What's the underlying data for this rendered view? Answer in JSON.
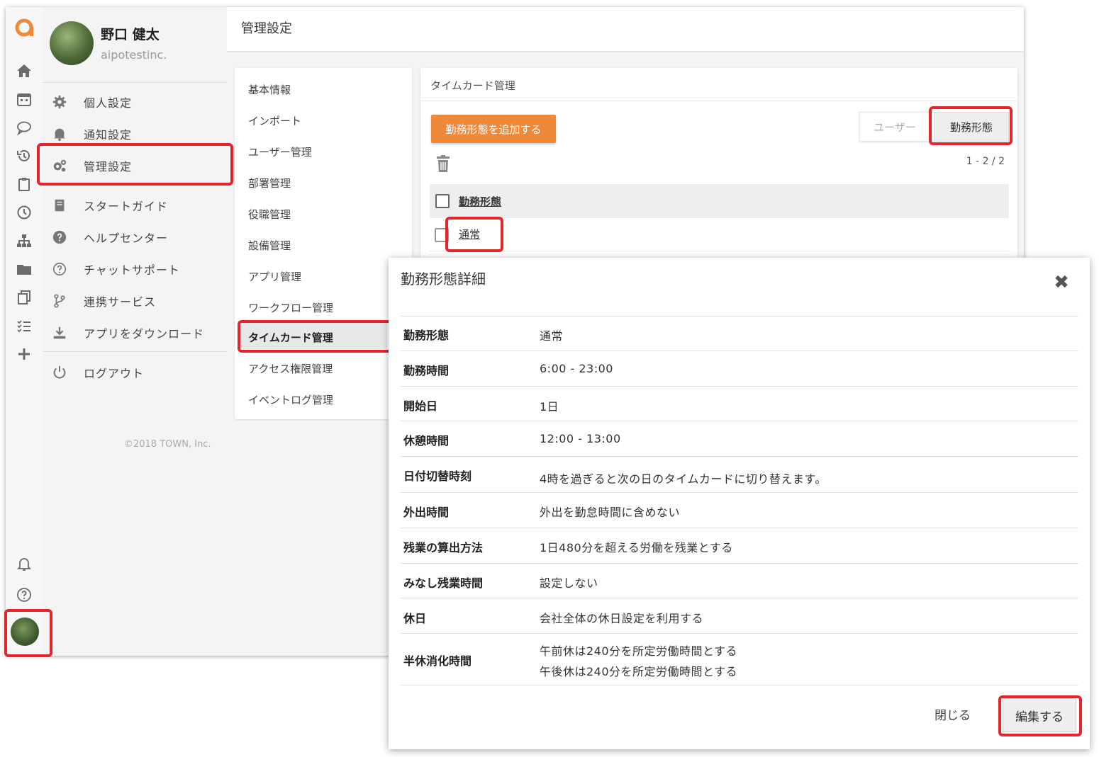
{
  "user": {
    "name": "野口 健太",
    "org": "aipotestinc."
  },
  "side_menu": {
    "items": [
      {
        "label": "個人設定",
        "icon": "gear-icon"
      },
      {
        "label": "通知設定",
        "icon": "bell-icon"
      },
      {
        "label": "管理設定",
        "icon": "gears-icon"
      },
      {
        "label": "スタートガイド",
        "icon": "book-icon"
      },
      {
        "label": "ヘルプセンター",
        "icon": "help-circle-icon"
      },
      {
        "label": "チャットサポート",
        "icon": "question-outline-icon"
      },
      {
        "label": "連携サービス",
        "icon": "branch-icon"
      },
      {
        "label": "アプリをダウンロード",
        "icon": "download-icon"
      },
      {
        "label": "ログアウト",
        "icon": "power-icon"
      }
    ],
    "copyright": "©2018 TOWN, Inc."
  },
  "header": {
    "title": "管理設定"
  },
  "admin_menu": {
    "items": [
      "基本情報",
      "インポート",
      "ユーザー管理",
      "部署管理",
      "役職管理",
      "設備管理",
      "アプリ管理",
      "ワークフロー管理",
      "タイムカード管理",
      "アクセス権限管理",
      "イベントログ管理"
    ],
    "active": "タイムカード管理"
  },
  "card": {
    "title": "タイムカード管理",
    "add_button": "勤務形態を追加する",
    "toggle_user": "ユーザー",
    "toggle_type": "勤務形態",
    "pager": "1 - 2 / 2",
    "column_header": "勤務形態",
    "rows": [
      "通常"
    ]
  },
  "dialog": {
    "title": "勤務形態詳細",
    "fields": [
      {
        "label": "勤務形態",
        "value": "通常"
      },
      {
        "label": "勤務時間",
        "value": "6:00 - 23:00"
      },
      {
        "label": "開始日",
        "value": "1日"
      },
      {
        "label": "休憩時間",
        "value": "12:00 - 13:00"
      },
      {
        "label": "日付切替時刻",
        "value": "4時を過ぎると次の日のタイムカードに切り替えます。"
      },
      {
        "label": "外出時間",
        "value": "外出を勤怠時間に含めない"
      },
      {
        "label": "残業の算出方法",
        "value": "1日480分を超える労働を残業とする"
      },
      {
        "label": "みなし残業時間",
        "value": "設定しない"
      },
      {
        "label": "休日",
        "value": "会社全体の休日設定を利用する"
      },
      {
        "label": "半休消化時間",
        "value": "午前休は240分を所定労働時間とする",
        "value2": "午後休は240分を所定労働時間とする"
      }
    ],
    "close_button": "閉じる",
    "edit_button": "編集する"
  },
  "colors": {
    "accent_orange": "#f0883a",
    "highlight_red": "#e5242b"
  }
}
